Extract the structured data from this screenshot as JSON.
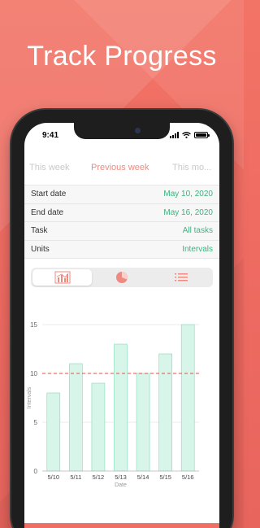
{
  "headline": "Track Progress",
  "status": {
    "time": "9:41"
  },
  "week_tabs": [
    "This week",
    "Previous week",
    "This mo..."
  ],
  "settings": [
    {
      "label": "Start date",
      "value": "May 10, 2020"
    },
    {
      "label": "End date",
      "value": "May 16, 2020"
    },
    {
      "label": "Task",
      "value": "All tasks"
    },
    {
      "label": "Units",
      "value": "Intervals"
    }
  ],
  "view_modes": [
    {
      "icon": "bar-chart-icon",
      "selected": true
    },
    {
      "icon": "pie-chart-icon",
      "selected": false
    },
    {
      "icon": "list-icon",
      "selected": false
    }
  ],
  "tabbar": [
    "log-icon",
    "timer-icon",
    "stats-icon",
    "settings-icon",
    "info-icon"
  ],
  "colors": {
    "accent": "#f16e64",
    "bar_fill": "#d8f5ea",
    "bar_stroke": "#7fdcb6",
    "value_green": "#3db37e",
    "target_line": "#e04f45"
  },
  "chart_data": {
    "type": "bar",
    "categories": [
      "5/10",
      "5/11",
      "5/12",
      "5/13",
      "5/14",
      "5/15",
      "5/16"
    ],
    "values": [
      8,
      11,
      9,
      13,
      10,
      12,
      15
    ],
    "ylim": [
      0,
      15
    ],
    "yticks": [
      0,
      5,
      10,
      15
    ],
    "ylabel": "Intervals",
    "xlabel": "Date",
    "target": 10
  }
}
